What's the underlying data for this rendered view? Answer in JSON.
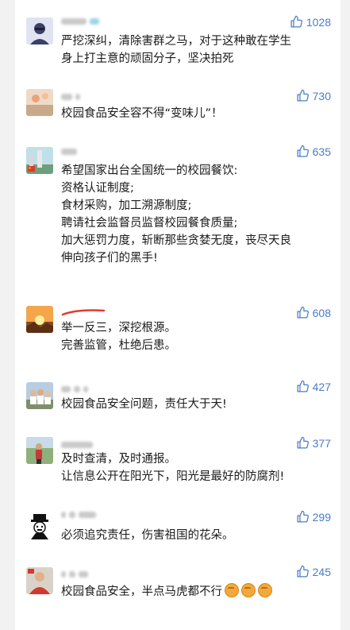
{
  "colors": {
    "accent": "#4a7cc7",
    "text": "#1a1a1a",
    "background": "#f2f2f2"
  },
  "comments": [
    {
      "likes": "1028",
      "lines": [
        "严挖深纠，清除害群之马，对于这种敢在学生",
        "身上打主意的顽固分子，坚决拍死"
      ]
    },
    {
      "likes": "730",
      "lines": [
        "校园食品安全容不得“变味儿”！"
      ]
    },
    {
      "likes": "635",
      "lines": [
        "希望国家出台全国统一的校园餐饮:",
        "资格认证制度;",
        "食材采购，加工溯源制度;",
        "聘请社会监督员监督校园餐食质量;",
        "加大惩罚力度，斩断那些贪婪无度，丧尽天良",
        "伸向孩子们的黑手!"
      ]
    },
    {
      "likes": "608",
      "lines": [
        "举一反三，深挖根源。",
        "完善监管，杜绝后患。"
      ]
    },
    {
      "likes": "427",
      "lines": [
        "校园食品安全问题，责任大于天!"
      ]
    },
    {
      "likes": "377",
      "lines": [
        "及时查清，及时通报。",
        "让信息公开在阳光下，阳光是最好的防腐剂!"
      ]
    },
    {
      "likes": "299",
      "lines": [
        "必须追究责任，伤害祖国的花朵。"
      ]
    },
    {
      "likes": "245",
      "lines": [
        "校园食品安全，半点马虎都不行"
      ]
    }
  ]
}
